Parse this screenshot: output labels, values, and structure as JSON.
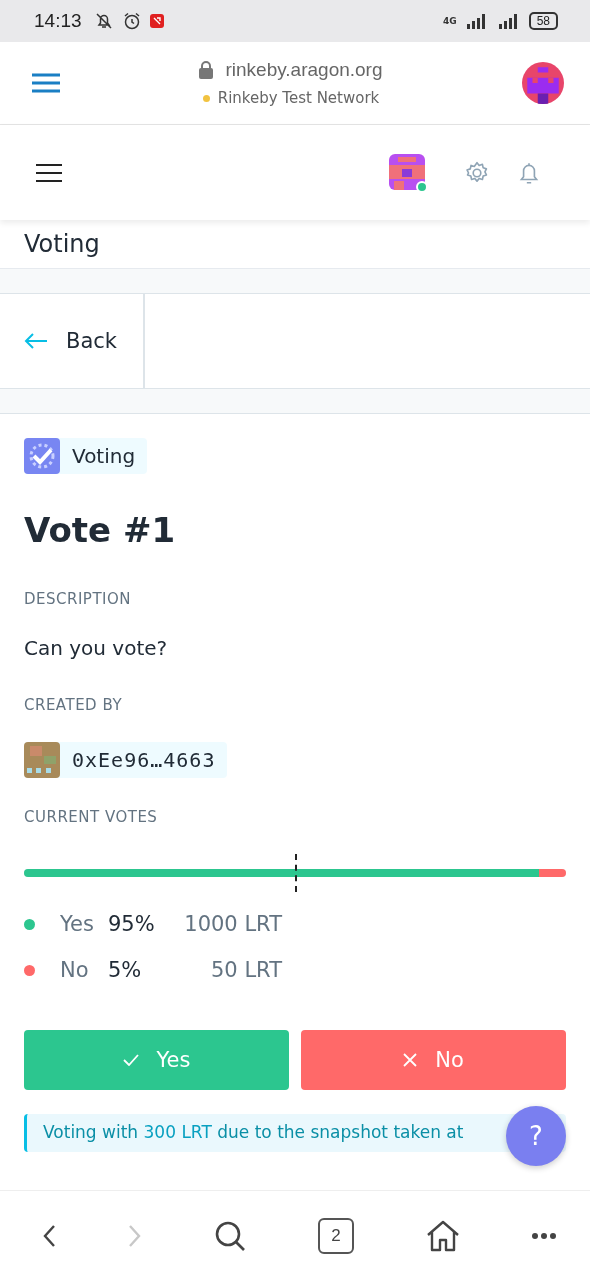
{
  "status_bar": {
    "time": "14:13",
    "network": "4G",
    "battery": "58"
  },
  "browser": {
    "url": "rinkeby.aragon.org",
    "network_name": "Rinkeby Test Network"
  },
  "page_title": "Voting",
  "back": {
    "label": "Back"
  },
  "vote": {
    "app_badge": "Voting",
    "title": "Vote #1",
    "description_label": "DESCRIPTION",
    "description": "Can you vote?",
    "created_by_label": "CREATED BY",
    "creator": "0xEe96…4663",
    "votes_label": "CURRENT VOTES",
    "support_marker": {
      "level": 0.5
    },
    "options": [
      {
        "label": "Yes",
        "percent": "95%",
        "amount": "1000 LRT",
        "color": "#2cc68f",
        "level": 0.95
      },
      {
        "label": "No",
        "percent": "5%",
        "amount": "50 LRT",
        "color": "#ff6969",
        "level": 0.05
      }
    ],
    "buttons": [
      {
        "kind": "yes",
        "label": "Yes"
      },
      {
        "kind": "no",
        "label": "No"
      }
    ],
    "info": "Voting with **300 LRT** due to the snapshot taken at"
  },
  "help": "?",
  "bottom_nav": {
    "tab_count": "2"
  }
}
